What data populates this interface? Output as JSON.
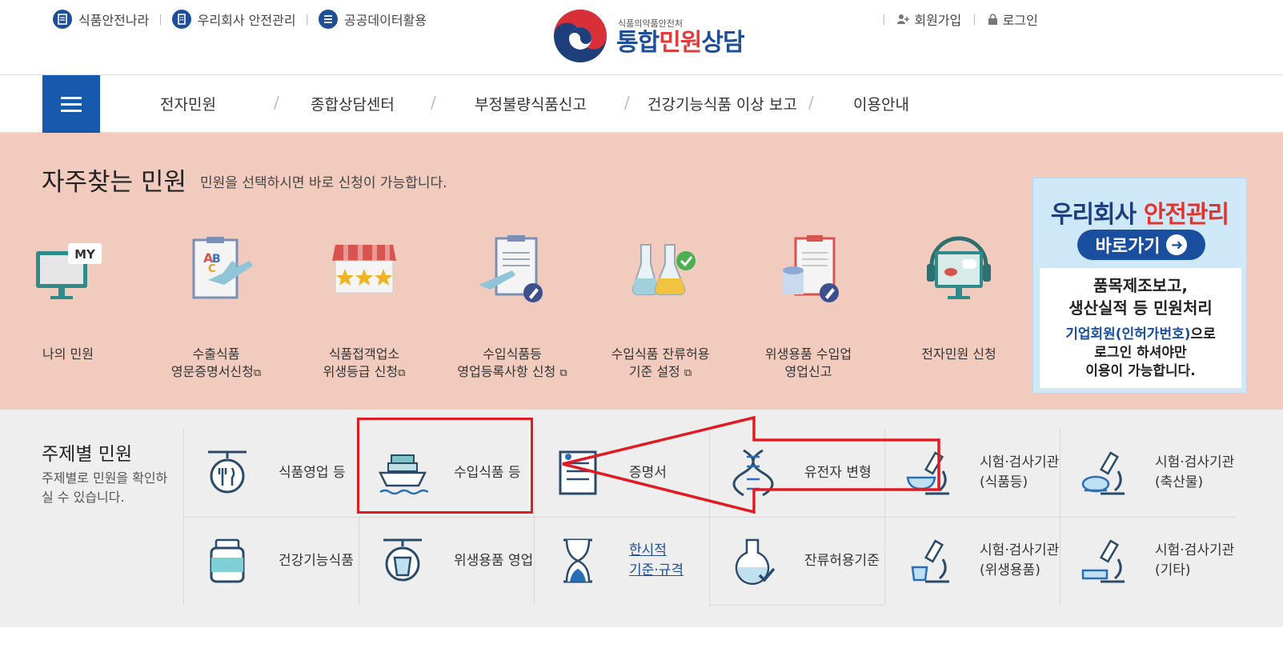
{
  "util_links": {
    "food_safety": "식품안전나라",
    "company_safety": "우리회사 안전관리",
    "public_data": "공공데이터활용",
    "signup": "회원가입",
    "login": "로그인"
  },
  "logo": {
    "agency": "식품의약품안전처",
    "title_part1": "통합",
    "title_part2": "민원",
    "title_part3": "상담"
  },
  "nav": {
    "items": [
      "전자민원",
      "종합상담센터",
      "부정불량식품신고",
      "건강기능식품 이상 보고",
      "이용안내"
    ]
  },
  "frequent": {
    "title": "자주찾는 민원",
    "subtitle": "민원을 선택하시면 바로 신청이 가능합니다.",
    "items": [
      {
        "line1": "나의 민원",
        "line2": ""
      },
      {
        "line1": "수출식품",
        "line2": "영문증명서신청"
      },
      {
        "line1": "식품접객업소",
        "line2": "위생등급 신청"
      },
      {
        "line1": "수입식품등",
        "line2": "영업등록사항 신청"
      },
      {
        "line1": "수입식품 잔류허용",
        "line2": "기준 설정"
      },
      {
        "line1": "위생용품 수입업",
        "line2": "영업신고"
      },
      {
        "line1": "전자민원 신청",
        "line2": ""
      }
    ],
    "ext_symbol": "⧉",
    "my_badge": "MY"
  },
  "banner": {
    "title_part1": "우리회사 ",
    "title_part2": "안전관리",
    "button": "바로가기",
    "line1": "품목제조보고,",
    "line2": "생산실적 등 민원처리",
    "line3_blue": "기업회원(인허가번호)",
    "line3_rest": "으로",
    "line4": "로그인 하셔야만",
    "line5": "이용이 가능합니다."
  },
  "topic": {
    "title": "주제별 민원",
    "desc": "주제별로 민원을 확인하실 수 있습니다.",
    "row1": [
      {
        "l1": "식품영업 등",
        "l2": ""
      },
      {
        "l1": "수입식품 등",
        "l2": ""
      },
      {
        "l1": "증명서",
        "l2": ""
      },
      {
        "l1": "유전자 변형",
        "l2": ""
      },
      {
        "l1": "시험·검사기관",
        "l2": "(식품등)"
      },
      {
        "l1": "시험·검사기관",
        "l2": "(축산물)"
      }
    ],
    "row2": [
      {
        "l1": "건강기능식품",
        "l2": ""
      },
      {
        "l1": "위생용품 영업",
        "l2": ""
      },
      {
        "l1": "한시적",
        "l2": "기준·규격"
      },
      {
        "l1": "잔류허용기준",
        "l2": ""
      },
      {
        "l1": "시험·검사기관",
        "l2": "(위생용품)"
      },
      {
        "l1": "시험·검사기관",
        "l2": "(기타)"
      }
    ]
  },
  "colors": {
    "brand_blue": "#1759ad",
    "freq_bg": "#f1cbbd",
    "annotation_red": "#e01b24"
  }
}
